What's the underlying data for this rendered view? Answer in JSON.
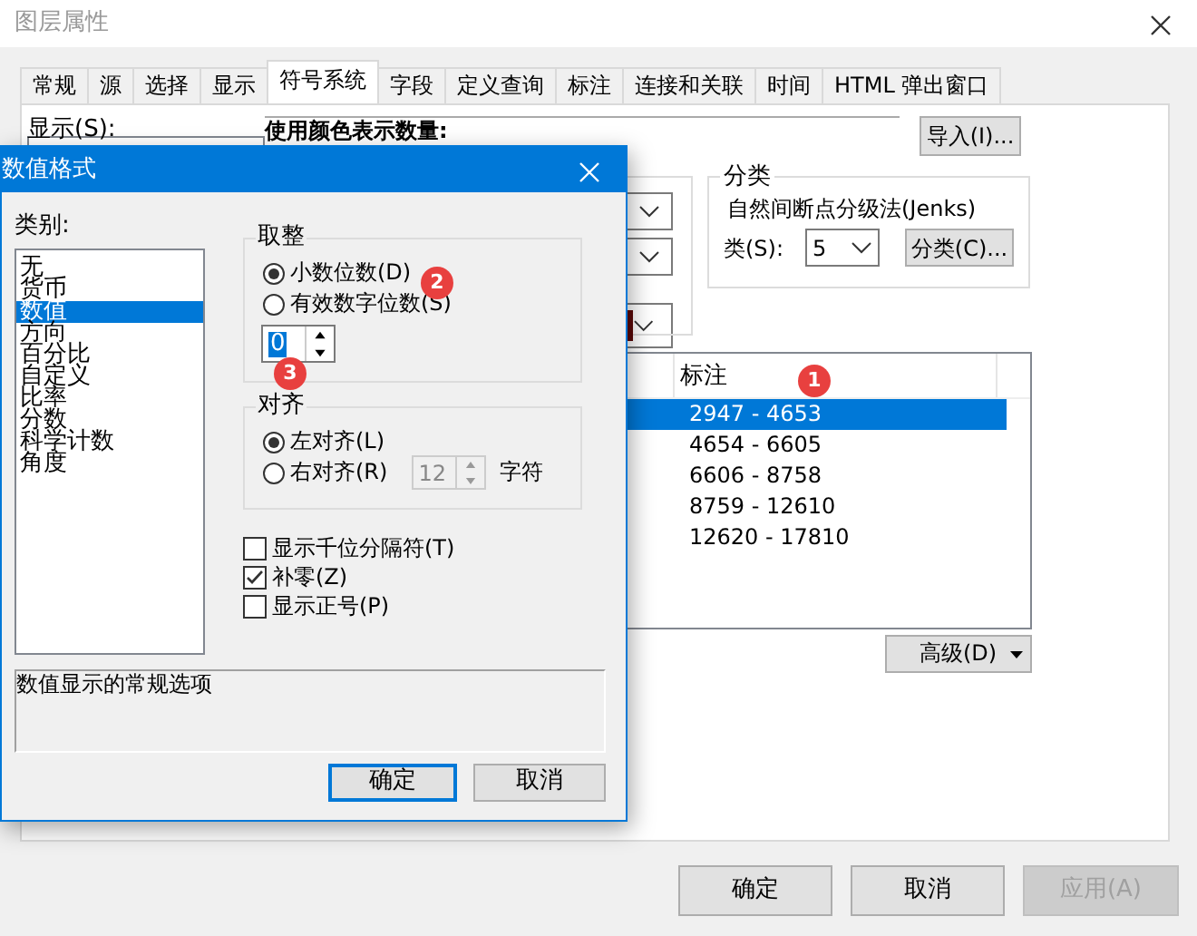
{
  "window": {
    "title": "图层属性"
  },
  "tabs": [
    {
      "label": "常规",
      "selected": false
    },
    {
      "label": "源",
      "selected": false
    },
    {
      "label": "选择",
      "selected": false
    },
    {
      "label": "显示",
      "selected": false
    },
    {
      "label": "符号系统",
      "selected": true
    },
    {
      "label": "字段",
      "selected": false
    },
    {
      "label": "定义查询",
      "selected": false
    },
    {
      "label": "标注",
      "selected": false
    },
    {
      "label": "连接和关联",
      "selected": false
    },
    {
      "label": "时间",
      "selected": false
    },
    {
      "label": "HTML 弹出窗口",
      "selected": false
    }
  ],
  "show_label": "显示(S):",
  "heading": "使用颜色表示数量:",
  "import_button": "导入(I)...",
  "classification": {
    "title": "分类",
    "method": "自然间断点分级法(Jenks)",
    "classes_label": "类(S):",
    "classes_value": "5",
    "button": "分类(C)..."
  },
  "table": {
    "columns": [
      "标注"
    ],
    "rows": [
      {
        "label": "2947 - 4653",
        "selected": true
      },
      {
        "label": "4654 - 6605",
        "selected": false
      },
      {
        "label": "6606 - 8758",
        "selected": false
      },
      {
        "label": "8759 - 12610",
        "selected": false
      },
      {
        "label": "12620 - 17810",
        "selected": false
      }
    ]
  },
  "advanced_button": "高级(D)",
  "footer_buttons": [
    {
      "label": "确定",
      "disabled": false
    },
    {
      "label": "取消",
      "disabled": false
    },
    {
      "label": "应用(A)",
      "disabled": true
    }
  ],
  "dialog": {
    "title": "数值格式",
    "category_label": "类别:",
    "categories": [
      {
        "label": "无",
        "selected": false
      },
      {
        "label": "货币",
        "selected": false
      },
      {
        "label": "数值",
        "selected": true
      },
      {
        "label": "方向",
        "selected": false
      },
      {
        "label": "百分比",
        "selected": false
      },
      {
        "label": "自定义",
        "selected": false
      },
      {
        "label": "比率",
        "selected": false
      },
      {
        "label": "分数",
        "selected": false
      },
      {
        "label": "科学计数",
        "selected": false
      },
      {
        "label": "角度",
        "selected": false
      }
    ],
    "rounding": {
      "title": "取整",
      "options": [
        {
          "label": "小数位数(D)",
          "selected": true
        },
        {
          "label": "有效数字位数(S)",
          "selected": false
        }
      ],
      "digits": "0"
    },
    "alignment": {
      "title": "对齐",
      "options": [
        {
          "label": "左对齐(L)",
          "selected": true
        },
        {
          "label": "右对齐(R)",
          "selected": false
        }
      ],
      "width_value": "12",
      "width_unit": "字符"
    },
    "checkboxes": [
      {
        "label": "显示千位分隔符(T)",
        "checked": false
      },
      {
        "label": "补零(Z)",
        "checked": true
      },
      {
        "label": "显示正号(P)",
        "checked": false
      }
    ],
    "description": "数值显示的常规选项",
    "buttons": [
      {
        "label": "确定",
        "default": true
      },
      {
        "label": "取消",
        "default": false
      }
    ]
  },
  "markers": [
    "1",
    "2",
    "3"
  ]
}
